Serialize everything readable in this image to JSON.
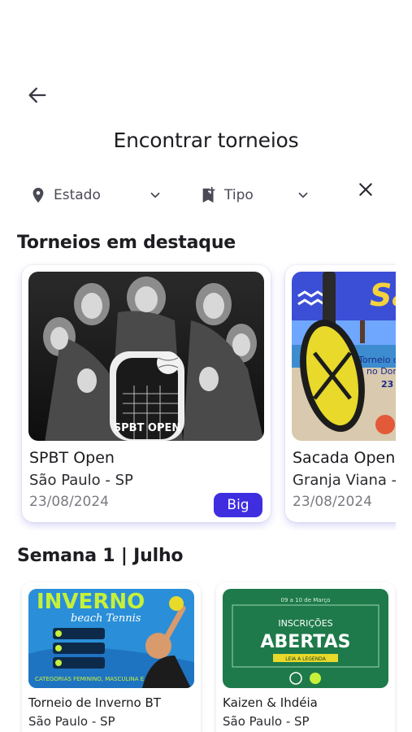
{
  "header": {
    "back_icon": "arrow-left-icon",
    "title": "Encontrar torneios"
  },
  "filters": {
    "estado": {
      "icon": "location-pin-icon",
      "label": "Estado"
    },
    "tipo": {
      "icon": "bookmark-plus-icon",
      "label": "Tipo"
    },
    "clear_icon": "close-icon"
  },
  "featured": {
    "title": "Torneios em destaque",
    "cards": [
      {
        "name": "SPBT Open",
        "location": "São Paulo - SP",
        "date": "23/08/2024",
        "badge": "Big",
        "image_text": "SPBT OPEN"
      },
      {
        "name": "Sacada Open",
        "location": "Granja Viana -",
        "date": "23/08/2024",
        "image_text": "Sa",
        "image_caption": "Torneio d",
        "image_caption2": "no Don",
        "image_date": "23"
      }
    ]
  },
  "week": {
    "title": "Semana 1 | Julho",
    "cards": [
      {
        "name": "Torneio de Inverno BT",
        "location": "São Paulo - SP",
        "image_title": "INVERNO",
        "image_subtitle": "beach Tennis",
        "image_footer": "CATEGORIAS FEMININO, MASCULINA E MISTA"
      },
      {
        "name": "Kaizen & Ihdéia",
        "location": "São Paulo - SP",
        "image_top": "INSCRIÇÕES",
        "image_title": "ABERTAS",
        "image_sub": "LEIA A LEGENDA",
        "image_date": "09 a 10 de Março"
      }
    ]
  },
  "colors": {
    "accent": "#3f2de0",
    "shadow": "#8a7ff0",
    "green": "#1e7a4a",
    "lime": "#c6f03a"
  }
}
